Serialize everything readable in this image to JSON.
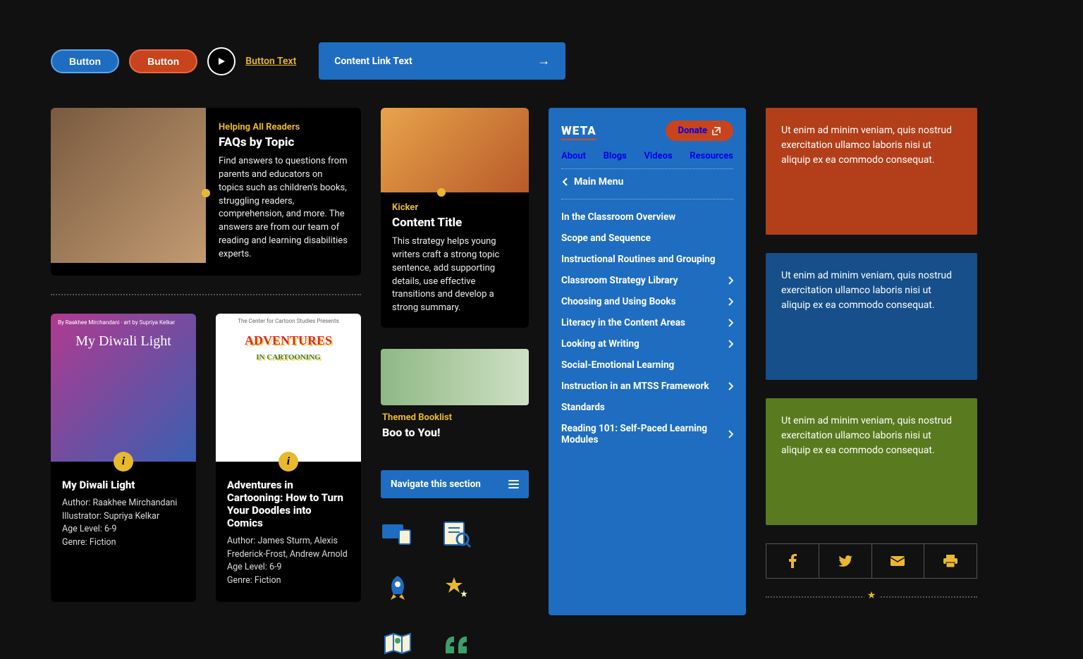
{
  "top": {
    "blue_button": "Button",
    "orange_button": "Button",
    "link_text": "Button Text",
    "content_link": "Content Link Text"
  },
  "feature": {
    "kicker": "Helping All Readers",
    "title": "FAQs by Topic",
    "desc": "Find answers to questions from parents and educators on topics such as children's books, struggling readers, comprehension, and more. The answers are from our team of reading and learning disabilities experts."
  },
  "small_card": {
    "kicker": "Kicker",
    "title": "Content Title",
    "desc": "This strategy helps young writers craft a strong topic sentence, add supporting details, use effective transitions and develop a strong summary."
  },
  "books": [
    {
      "cover_text": "My Diwali Light",
      "byline_top": "By Raakhee Mirchandani · art by Supriya Kelkar",
      "title": "My Diwali Light",
      "author": "Author: Raakhee Mirchandani",
      "illustrator": "Illustrator: Supriya Kelkar",
      "age": "Age Level: 6-9",
      "genre": "Genre: Fiction"
    },
    {
      "cover_text_1": "ADVENTURES",
      "cover_text_2": "IN CARTOONING",
      "title": "Adventures in Cartooning: How to Turn Your Doodles into Comics",
      "author": "Author: James Sturm, Alexis Frederick-Frost, Andrew Arnold",
      "age": "Age Level: 6-9",
      "genre": "Genre: Fiction"
    }
  ],
  "boo": {
    "kicker": "Themed Booklist",
    "title": "Boo to You!"
  },
  "nav_section": "Navigate this section",
  "menu": {
    "logo": "WETA",
    "donate": "Donate",
    "nav": [
      "About",
      "Blogs",
      "Videos",
      "Resources"
    ],
    "breadcrumb": "Main Menu",
    "items": [
      {
        "label": "In the Classroom Overview",
        "chev": false
      },
      {
        "label": "Scope and Sequence",
        "chev": false
      },
      {
        "label": "Instructional Routines and Grouping",
        "chev": false
      },
      {
        "label": "Classroom Strategy Library",
        "chev": true
      },
      {
        "label": "Choosing and Using Books",
        "chev": true
      },
      {
        "label": "Literacy in the Content Areas",
        "chev": true
      },
      {
        "label": "Looking at Writing",
        "chev": true
      },
      {
        "label": "Social-Emotional Learning",
        "chev": false
      },
      {
        "label": "Instruction in an MTSS Framework",
        "chev": true
      },
      {
        "label": "Standards",
        "chev": false
      },
      {
        "label": "Reading 101: Self-Paced Learning Modules",
        "chev": true
      }
    ]
  },
  "boxes": {
    "text": "Ut enim ad minim veniam, quis nostrud exercitation ullamco laboris nisi ut aliquip ex ea commodo consequat."
  }
}
